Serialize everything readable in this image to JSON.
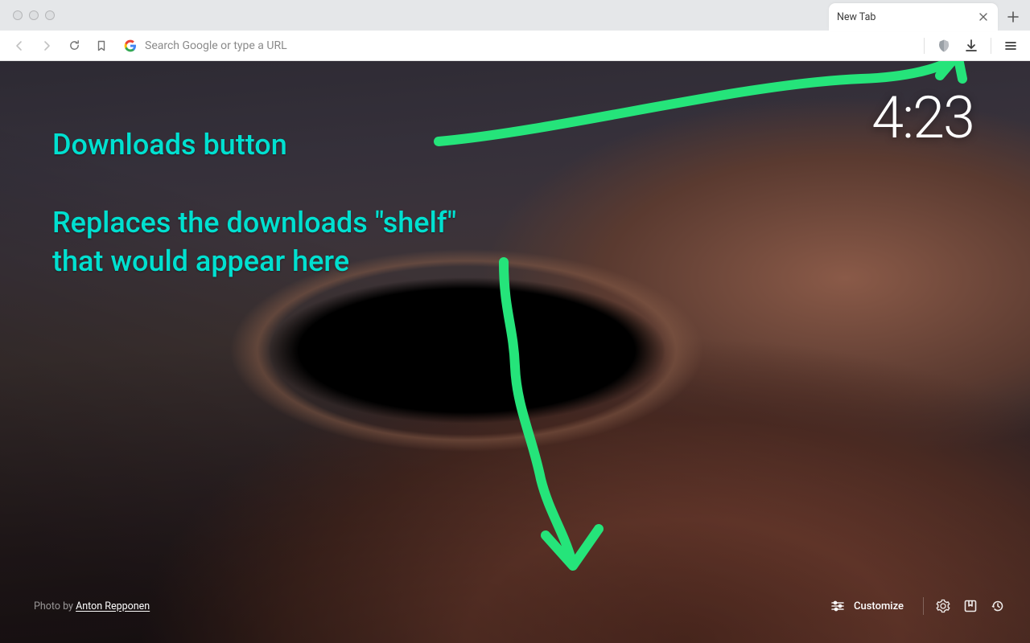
{
  "titlebar": {
    "tab_title": "New Tab"
  },
  "toolbar": {
    "search_placeholder": "Search Google or type a URL"
  },
  "ntp": {
    "clock": "4:23",
    "annotation_line1": "Downloads button",
    "annotation_line2a": "Replaces the downloads \"shelf\"",
    "annotation_line2b": "that would appear here",
    "photo_prefix": "Photo by ",
    "photo_author": "Anton Repponen",
    "customize_label": "Customize",
    "annotation_color": "#00e0d0",
    "scribble_color": "#25e47a"
  }
}
